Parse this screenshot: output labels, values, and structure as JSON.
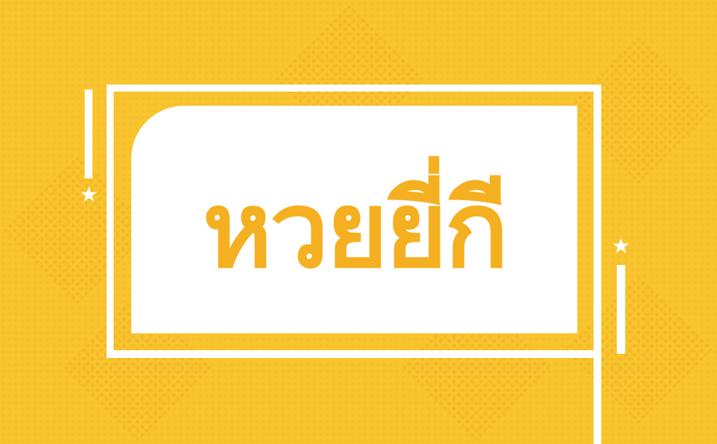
{
  "banner": {
    "title": "หวยยี่กี",
    "colors": {
      "background": "#F8C52F",
      "text": "#F4B020",
      "frame": "#FFFFFF"
    },
    "icons": [
      "star-icon",
      "star-icon"
    ]
  }
}
